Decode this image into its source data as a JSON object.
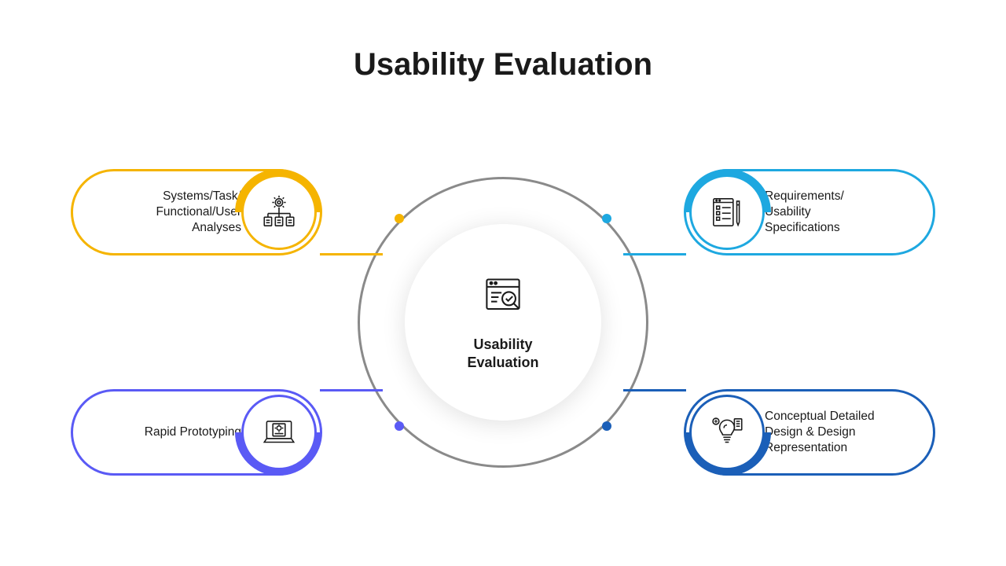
{
  "title": "Usability Evaluation",
  "center": {
    "label": "Usability\nEvaluation"
  },
  "nodes": {
    "top_left": {
      "label": "Systems/Task/\nFunctional/User\nAnalyses",
      "color": "#f5b400",
      "icon": "org-gear-icon"
    },
    "top_right": {
      "label": "Requirements/\nUsability\nSpecifications",
      "color": "#1ea8e0",
      "icon": "spec-doc-icon"
    },
    "bottom_left": {
      "label": "Rapid Prototyping",
      "color": "#5a5af5",
      "icon": "prototype-laptop-icon"
    },
    "bottom_right": {
      "label": "Conceptual Detailed\nDesign & Design\nRepresentation",
      "color": "#1b5fb8",
      "icon": "design-idea-icon"
    }
  }
}
